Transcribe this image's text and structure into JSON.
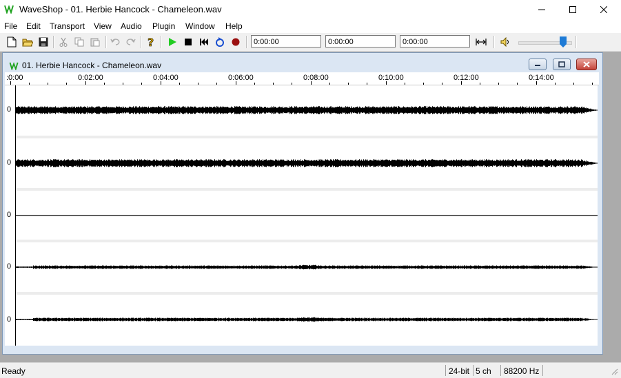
{
  "window": {
    "title": "WaveShop - 01. Herbie Hancock - Chameleon.wav"
  },
  "menu": [
    "File",
    "Edit",
    "Transport",
    "View",
    "Audio",
    "Plugin",
    "Window",
    "Help"
  ],
  "toolbar": {
    "icons": [
      "new-file-icon",
      "open-folder-icon",
      "save-icon",
      "cut-icon",
      "copy-icon",
      "paste-icon",
      "undo-icon",
      "redo-icon",
      "help-icon",
      "play-icon",
      "stop-icon",
      "rewind-icon",
      "loop-icon",
      "record-icon"
    ],
    "time_fields": [
      "0:00:00",
      "0:00:00",
      "0:00:00"
    ],
    "volume_level": 0.9
  },
  "document": {
    "title": "01. Herbie Hancock - Chameleon.wav",
    "ruler_labels": [
      ":0:00",
      "0:02:00",
      "0:04:00",
      "0:06:00",
      "0:08:00",
      "0:10:00",
      "0:12:00",
      "0:14:00"
    ],
    "channels": [
      {
        "label": "0",
        "amplitude": 0.16
      },
      {
        "label": "0",
        "amplitude": 0.16
      },
      {
        "label": "0",
        "amplitude": 0.0
      },
      {
        "label": "0",
        "amplitude": 0.07
      },
      {
        "label": "0",
        "amplitude": 0.07
      }
    ]
  },
  "status": {
    "text": "Ready",
    "bit_depth": "24-bit",
    "channels": "5 ch",
    "rate": "88200 Hz"
  }
}
